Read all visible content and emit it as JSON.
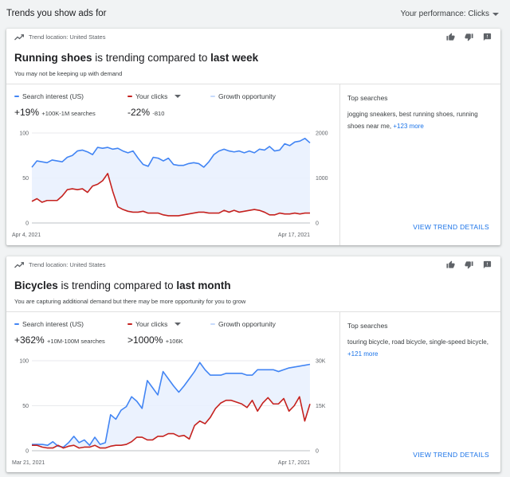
{
  "page": {
    "title": "Trends you show ads for",
    "performance_label": "Your performance: Clicks"
  },
  "cards": [
    {
      "location": "Trend location: United States",
      "headline_term": "Running shoes",
      "headline_mid": " is trending compared to ",
      "headline_period": "last week",
      "subtitle": "You may not be keeping up with demand",
      "legend": {
        "search": "Search interest (US)",
        "clicks": "Your clicks",
        "growth": "Growth opportunity"
      },
      "search_stat": "+19%",
      "search_range": "+100K-1M searches",
      "clicks_stat": "-22%",
      "clicks_delta": "-810",
      "top_searches_title": "Top searches",
      "top_searches": "jogging sneakers, best running shoes, running shoes near me, ",
      "more_link": "+123 more",
      "view_details": "VIEW TREND DETAILS",
      "chart_data": {
        "type": "line",
        "x_start_label": "Apr 4, 2021",
        "x_end_label": "Apr 17, 2021",
        "y_left_ticks": [
          "100",
          "50",
          "0"
        ],
        "y_right_ticks": [
          "2000",
          "1000",
          "0"
        ],
        "ylim_left": [
          0,
          100
        ],
        "ylim_right": [
          0,
          2000
        ],
        "series": [
          {
            "name": "Search interest (US)",
            "color": "#4285f4",
            "values": [
              62,
              69,
              68,
              67,
              70,
              69,
              68,
              73,
              75,
              80,
              81,
              79,
              76,
              84,
              83,
              84,
              82,
              83,
              80,
              78,
              80,
              72,
              65,
              63,
              73,
              72,
              69,
              72,
              65,
              64,
              64,
              66,
              67,
              66,
              62,
              68,
              76,
              80,
              82,
              80,
              79,
              80,
              78,
              80,
              78,
              82,
              81,
              85,
              80,
              81,
              88,
              86,
              90,
              91,
              94,
              89
            ]
          },
          {
            "name": "Your clicks",
            "color": "#c5221f",
            "values": [
              24,
              27,
              23,
              25,
              25,
              25,
              30,
              37,
              38,
              37,
              38,
              34,
              41,
              43,
              47,
              55,
              35,
              18,
              15,
              13,
              12,
              12,
              13,
              11,
              11,
              11,
              9,
              8,
              8,
              8,
              9,
              10,
              11,
              12,
              12,
              11,
              11,
              11,
              14,
              12,
              14,
              12,
              13,
              14,
              15,
              14,
              12,
              9,
              9,
              11,
              10,
              10,
              11,
              10,
              11,
              11
            ]
          }
        ]
      }
    },
    {
      "location": "Trend location: United States",
      "headline_term": "Bicycles",
      "headline_mid": " is trending compared to ",
      "headline_period": "last month",
      "subtitle": "You are capturing additional demand but there may be more opportunity for you to grow",
      "legend": {
        "search": "Search interest (US)",
        "clicks": "Your clicks",
        "growth": "Growth opportunity"
      },
      "search_stat": "+362%",
      "search_range": "+10M-100M searches",
      "clicks_stat": ">1000%",
      "clicks_delta": "+106K",
      "top_searches_title": "Top searches",
      "top_searches": "touring bicycle, road bicycle, single-speed bicycle, ",
      "more_link": "+121 more",
      "view_details": "VIEW TREND DETAILS",
      "chart_data": {
        "type": "line",
        "x_start_label": "Mar 21, 2021",
        "x_end_label": "Apr 17, 2021",
        "y_left_ticks": [
          "100",
          "50",
          "0"
        ],
        "y_right_ticks": [
          "30K",
          "15K",
          "0"
        ],
        "ylim_left": [
          0,
          100
        ],
        "ylim_right": [
          0,
          30000
        ],
        "series": [
          {
            "name": "Search interest (US)",
            "color": "#4285f4",
            "values": [
              7,
              7,
              7,
              6,
              10,
              5,
              4,
              9,
              16,
              9,
              12,
              6,
              15,
              7,
              9,
              40,
              35,
              45,
              49,
              60,
              55,
              47,
              78,
              70,
              62,
              88,
              80,
              72,
              65,
              72,
              80,
              88,
              98,
              90,
              84,
              84,
              84,
              86,
              86,
              86,
              86,
              84,
              84,
              90,
              90,
              90,
              90,
              88,
              90,
              92,
              93,
              94,
              95,
              96
            ]
          },
          {
            "name": "Your clicks",
            "color": "#c5221f",
            "values": [
              6,
              6,
              4,
              3,
              3,
              6,
              3,
              5,
              6,
              3,
              4,
              4,
              6,
              3,
              3,
              5,
              6,
              6,
              7,
              10,
              15,
              15,
              12,
              12,
              16,
              16,
              19,
              19,
              16,
              17,
              13,
              28,
              33,
              30,
              37,
              47,
              53,
              56,
              56,
              54,
              52,
              48,
              56,
              44,
              53,
              59,
              52,
              52,
              58,
              44,
              50,
              60,
              33,
              52
            ]
          }
        ]
      }
    }
  ]
}
